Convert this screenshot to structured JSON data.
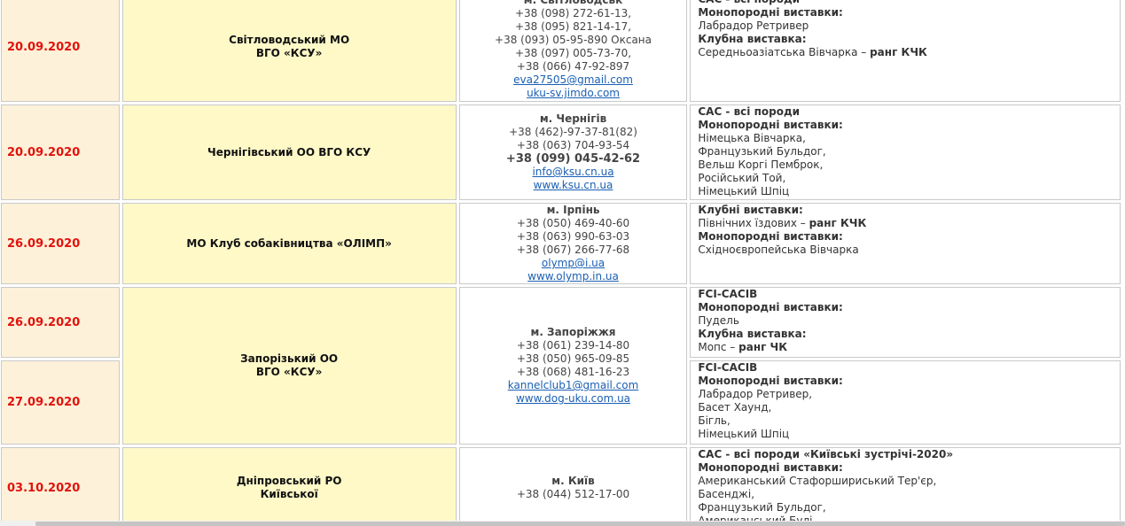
{
  "rows": [
    {
      "date": "20.09.2020",
      "org": [
        "Світловодський МО",
        "ВГО «КСУ»"
      ],
      "contact": {
        "city": "м. Світловодськ",
        "phones": [
          "+38 (098) 272-61-13,",
          "+38 (095) 821-14-17,",
          "+38 (093) 05-95-890 Оксана",
          "+38 (097) 005-73-70,",
          "+38 (066) 47-92-897"
        ],
        "links": [
          "eva27505@gmail.com",
          "uku-sv.jimdo.com"
        ]
      },
      "shows": [
        {
          "text": "САС - всі породи",
          "style": "label"
        },
        {
          "text": "Монопородні виставки:",
          "style": "label"
        },
        {
          "text": "Лабрадор Ретривер",
          "style": ""
        },
        {
          "text": "Клубна виставка:",
          "style": "label"
        },
        {
          "text": "Середньоазіатська Вівчарка – ",
          "suffix": "ранг КЧК",
          "style": ""
        }
      ]
    },
    {
      "date": "20.09.2020",
      "org": [
        "Чернігівський ОО ВГО КСУ"
      ],
      "contact": {
        "city": "м. Чернігів",
        "phones": [
          "+38 (462)-97-37-81(82)",
          "+38 (063) 704-93-54"
        ],
        "phone_bold": "+38 (099) 045-42-62",
        "links": [
          "info@ksu.cn.ua",
          "www.ksu.cn.ua"
        ]
      },
      "shows": [
        {
          "text": "САС - всі породи",
          "style": "label"
        },
        {
          "text": "Монопородні виставки:",
          "style": "label"
        },
        {
          "text": "Німецька Вівчарка,",
          "style": ""
        },
        {
          "text": "Французький Бульдог,",
          "style": ""
        },
        {
          "text": "Вельш Коргі Пемброк,",
          "style": ""
        },
        {
          "text": "Російський Той,",
          "style": ""
        },
        {
          "text": "Німецький Шпіц",
          "style": ""
        }
      ]
    },
    {
      "date": "26.09.2020",
      "org": [
        "МО Клуб собаківництва «ОЛІМП»"
      ],
      "contact": {
        "city": "м. Ірпінь",
        "phones": [
          "+38 (050) 469-40-60",
          "+38 (063) 990-63-03",
          "+38 (067) 266-77-68"
        ],
        "links": [
          "olymp@i.ua",
          "www.olymp.in.ua"
        ]
      },
      "shows": [
        {
          "text": "Клубні виставки:",
          "style": "label"
        },
        {
          "text": "Північних їздових – ",
          "suffix": "ранг КЧК",
          "style": ""
        },
        {
          "text": "Монопородні виставки:",
          "style": "label"
        },
        {
          "text": "Східноєвропейська Вівчарка",
          "style": ""
        }
      ]
    },
    {
      "date": "26.09.2020",
      "date2": "27.09.2020",
      "org": [
        "Запорізький ОО",
        "ВГО «КСУ»"
      ],
      "contact": {
        "city": "м. Запоріжжя",
        "phones": [
          "+38 (061) 239-14-80",
          "+38 (050) 965-09-85",
          "+38 (068) 481-16-23"
        ],
        "links": [
          "kannelclub1@gmail.com",
          "www.dog-uku.com.ua"
        ]
      },
      "shows": [
        {
          "text": "FCI-CACIB",
          "style": "label"
        },
        {
          "text": "Монопородні виставки:",
          "style": "label"
        },
        {
          "text": "Пудель",
          "style": ""
        },
        {
          "text": "Клубна виставка:",
          "style": "label"
        },
        {
          "text": "Мопс  – ",
          "suffix": "ранг ЧК",
          "style": ""
        }
      ],
      "shows2": [
        {
          "text": "FCI-CACIB",
          "style": "label"
        },
        {
          "text": "Монопородні виставки:",
          "style": "label"
        },
        {
          "text": "Лабрадор Ретривер,",
          "style": ""
        },
        {
          "text": "Басет Хаунд,",
          "style": ""
        },
        {
          "text": "Бігль,",
          "style": ""
        },
        {
          "text": "Німецький Шпіц",
          "style": ""
        }
      ]
    },
    {
      "date": "03.10.2020",
      "org": [
        "Дніпровський РО",
        "Київської"
      ],
      "contact": {
        "city": "м. Київ",
        "phones": [
          "+38 (044) 512-17-00"
        ],
        "links": []
      },
      "shows": [
        {
          "text": "САС - всі породи «Київські зустрічі-2020»",
          "style": "label"
        },
        {
          "text": "Монопородні виставки:",
          "style": "label"
        },
        {
          "text": "Американський Стафоршириський Тер'єр,",
          "style": ""
        },
        {
          "text": "Басенджі,",
          "style": ""
        },
        {
          "text": "Французький Бульдог,",
          "style": ""
        },
        {
          "text": "Американський Булі,",
          "style": ""
        }
      ]
    }
  ]
}
